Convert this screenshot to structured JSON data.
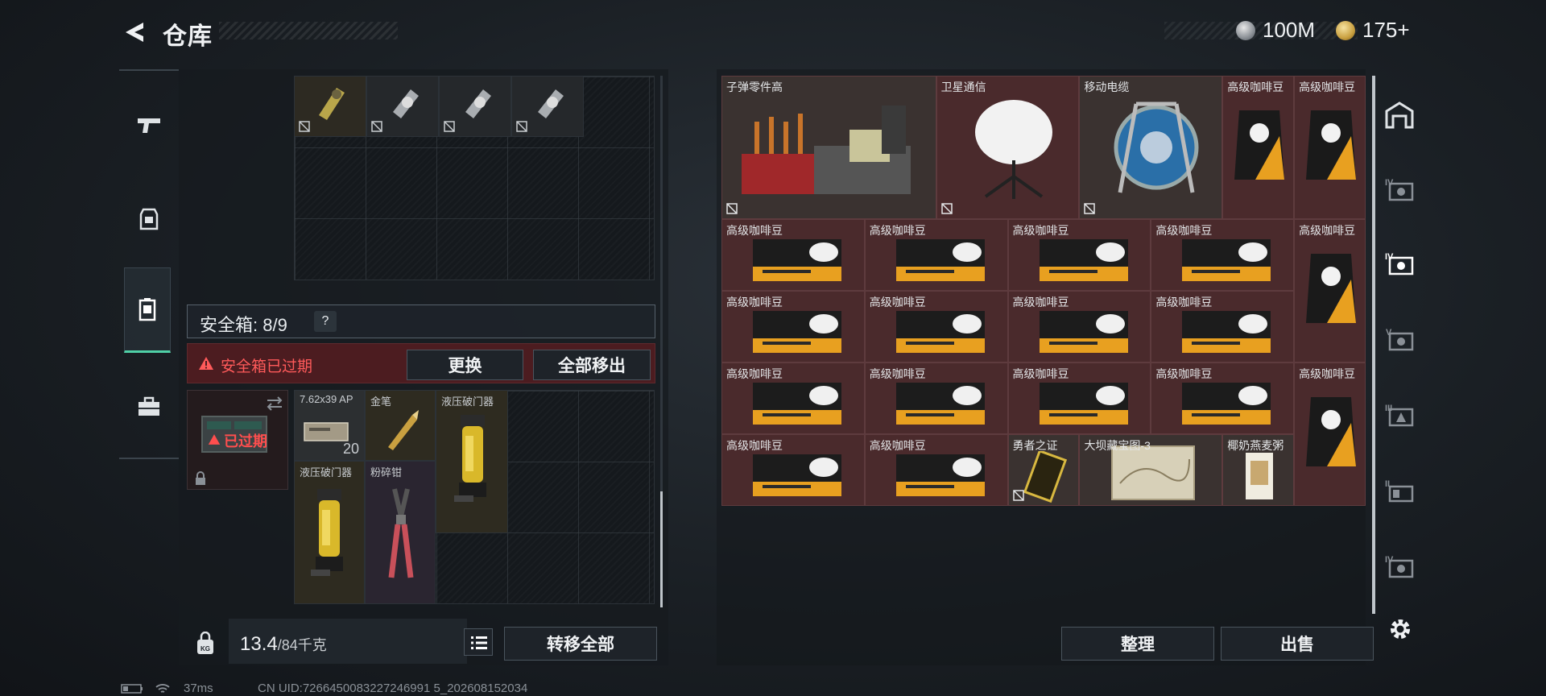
{
  "header": {
    "title": "仓库",
    "currency1": "100M",
    "currency2": "175+"
  },
  "left_tabs": [
    {
      "name": "weapons"
    },
    {
      "name": "armor"
    },
    {
      "name": "safebox",
      "active": true
    },
    {
      "name": "toolbox"
    }
  ],
  "backpack_items": [
    {
      "label": ""
    },
    {
      "label": ""
    },
    {
      "label": ""
    },
    {
      "label": ""
    }
  ],
  "safebox": {
    "label": "安全箱: 8/9",
    "help": "?",
    "warning": "安全箱已过期",
    "replace_button": "更换",
    "remove_all_button": "全部移出",
    "expired_badge": "已过期",
    "items": [
      {
        "label": "7.62x39 AP",
        "count": "20"
      },
      {
        "label": "金笔"
      },
      {
        "label": "液压破门器"
      },
      {
        "label": "液压破门器"
      },
      {
        "label": "粉碎钳"
      }
    ]
  },
  "footer_left": {
    "weight": "13.4",
    "weight_max": "/84千克",
    "transfer_button": "转移全部"
  },
  "stash_items": [
    {
      "label": "子弹零件高"
    },
    {
      "label": "卫星通信"
    },
    {
      "label": "移动电缆"
    },
    {
      "label": "高级咖啡豆"
    },
    {
      "label": "高级咖啡豆"
    },
    {
      "label": "高级咖啡豆"
    },
    {
      "label": "高级咖啡豆"
    },
    {
      "label": "高级咖啡豆"
    },
    {
      "label": "高级咖啡豆"
    },
    {
      "label": "高级咖啡豆"
    },
    {
      "label": "高级咖啡豆"
    },
    {
      "label": "高级咖啡豆"
    },
    {
      "label": "高级咖啡豆"
    },
    {
      "label": "高级咖啡豆"
    },
    {
      "label": "高级咖啡豆"
    },
    {
      "label": "高级咖啡豆"
    },
    {
      "label": "高级咖啡豆"
    },
    {
      "label": "高级咖啡豆"
    },
    {
      "label": "高级咖啡豆"
    },
    {
      "label": "高级咖啡豆"
    },
    {
      "label": "高级咖啡豆"
    },
    {
      "label": "勇者之证"
    },
    {
      "label": "大坝藏宝图-3"
    },
    {
      "label": "椰奶燕麦粥"
    }
  ],
  "footer_right": {
    "sort_button": "整理",
    "sell_button": "出售"
  },
  "right_tabs": [
    "stash-1",
    "stash-IV-1",
    "stash-IV-2",
    "stash-V",
    "stash-III",
    "stash-II",
    "stash-IV-3"
  ],
  "status": {
    "ping": "37ms",
    "uid": "CN UID:7266450083227246991 5_202608152034"
  },
  "colors": {
    "accent": "#4fd0a6",
    "warning": "#ff5a5a",
    "item_bg": "#4a2a2c"
  }
}
